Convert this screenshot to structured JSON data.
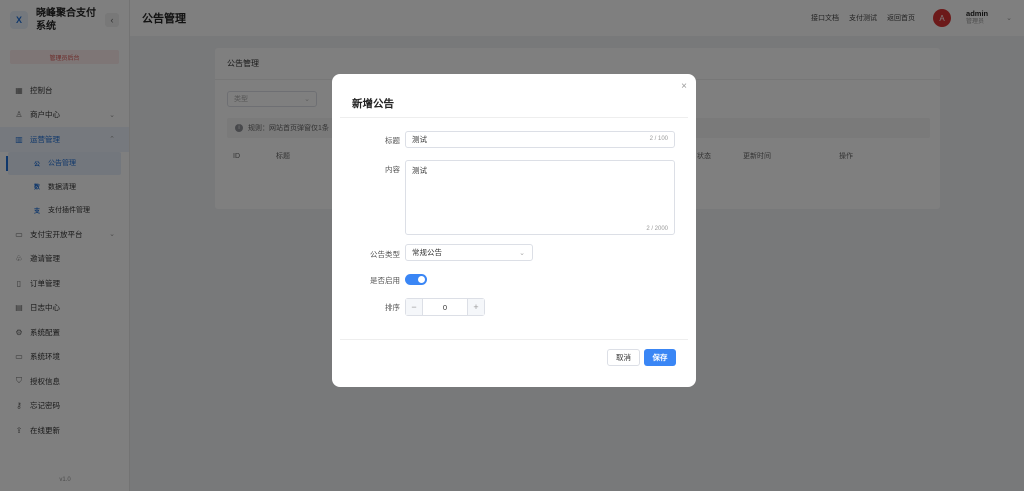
{
  "brand": {
    "logo": "X",
    "title": "晓峰聚合支付系统",
    "collapse": "‹"
  },
  "sidebar": {
    "role_badge": "管理员后台",
    "items": [
      {
        "label": "控制台",
        "icon": "▦",
        "icon_name": "dashboard-icon"
      },
      {
        "label": "商户中心",
        "icon": "♙",
        "icon_name": "user-icon",
        "arrow": "⌄"
      },
      {
        "label": "运营管理",
        "icon": "▥",
        "icon_name": "chart-bar-icon",
        "arrow": "⌃"
      },
      {
        "label": "支付宝开放平台",
        "icon": "▭",
        "icon_name": "card-icon",
        "arrow": "⌄"
      },
      {
        "label": "邀请管理",
        "icon": "♧",
        "icon_name": "invite-icon"
      },
      {
        "label": "订单管理",
        "icon": "▯",
        "icon_name": "order-icon"
      },
      {
        "label": "日志中心",
        "icon": "▤",
        "icon_name": "log-icon"
      },
      {
        "label": "系统配置",
        "icon": "⚙",
        "icon_name": "gear-icon"
      },
      {
        "label": "系统环境",
        "icon": "▭",
        "icon_name": "monitor-icon"
      },
      {
        "label": "授权信息",
        "icon": "⛉",
        "icon_name": "shield-icon"
      },
      {
        "label": "忘记密码",
        "icon": "⚷",
        "icon_name": "key-icon"
      },
      {
        "label": "在线更新",
        "icon": "⇪",
        "icon_name": "upload-icon"
      }
    ],
    "sub_items": [
      {
        "icon": "公",
        "label": "公告管理"
      },
      {
        "icon": "数",
        "label": "数据清理"
      },
      {
        "icon": "支",
        "label": "支付插件管理"
      }
    ],
    "version": "v1.0"
  },
  "header": {
    "title": "公告管理",
    "links": [
      "接口文档",
      "支付测试",
      "返回首页"
    ],
    "avatar": "A",
    "username": "admin",
    "user_role": "管理员",
    "caret": "⌄"
  },
  "main": {
    "card_title": "公告管理",
    "type_filter": {
      "placeholder": "类型",
      "caret": "⌄"
    },
    "notice": {
      "icon": "i",
      "text": "规则：网站首页弹窗仅1条"
    },
    "table_headers": [
      "ID",
      "标题",
      "状态",
      "更新时间",
      "操作"
    ]
  },
  "modal": {
    "title": "新增公告",
    "close": "×",
    "fields": {
      "title_label": "标题",
      "title_value": "测试",
      "title_counter": "2 / 100",
      "content_label": "内容",
      "content_value": "测试",
      "content_counter": "2 / 2000",
      "type_label": "公告类型",
      "type_value": "常规公告",
      "type_caret": "⌄",
      "enabled_label": "是否启用",
      "enabled": true,
      "sort_label": "排序",
      "sort_value": "0",
      "minus": "−",
      "plus": "+"
    },
    "buttons": {
      "cancel": "取消",
      "save": "保存"
    }
  },
  "colors": {
    "primary": "#3a86f5",
    "brand_red": "#d93434",
    "active_bg": "#e6eefa"
  }
}
